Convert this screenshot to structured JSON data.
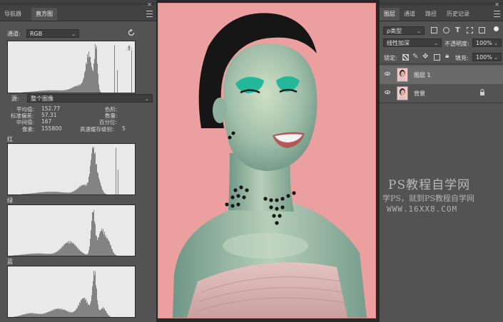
{
  "left_panel": {
    "tabs": [
      {
        "label": "导航器"
      },
      {
        "label": "直方图"
      }
    ],
    "channel_label": "通道:",
    "channel_value": "RGB",
    "source_label": "源:",
    "source_value": "整个图像",
    "stats": {
      "mean_label": "平均值:",
      "mean": "152.77",
      "stddev_label": "标准偏差:",
      "stddev": "57.31",
      "median_label": "中间值:",
      "median": "167",
      "pixels_label": "像素:",
      "pixels": "155800",
      "level_label": "色阶:",
      "count_label": "数量:",
      "percentile_label": "百分位:",
      "cache_label": "高速缓存级别:",
      "cache": "5"
    },
    "channels": [
      {
        "label": "红"
      },
      {
        "label": "绿"
      },
      {
        "label": "蓝"
      }
    ]
  },
  "right_panel": {
    "tabs": [
      {
        "label": "图层"
      },
      {
        "label": "通道"
      },
      {
        "label": "路径"
      },
      {
        "label": "历史记录"
      }
    ],
    "filter_label": "ρ类型",
    "blend_mode": "线性加深",
    "opacity_label": "不透明度:",
    "opacity": "100%",
    "lock_label": "锁定:",
    "fill_label": "填充:",
    "fill": "100%",
    "layers": [
      {
        "name": "图层 1",
        "selected": true
      },
      {
        "name": "背景",
        "selected": false,
        "locked": true
      }
    ]
  },
  "watermark": {
    "title": "PS教程自学网",
    "subtitle": "学PS，就到PS教程自学网",
    "url": "WWW.16XX8.COM"
  },
  "colors": {
    "panel": "#535353",
    "canvas_background": "#ec9f9f",
    "eyeshadow": "#22b89a"
  },
  "icons": [
    "refresh-icon",
    "warning-icon",
    "panel-menu-icon",
    "eye-icon",
    "lock-icon",
    "search-icon"
  ]
}
